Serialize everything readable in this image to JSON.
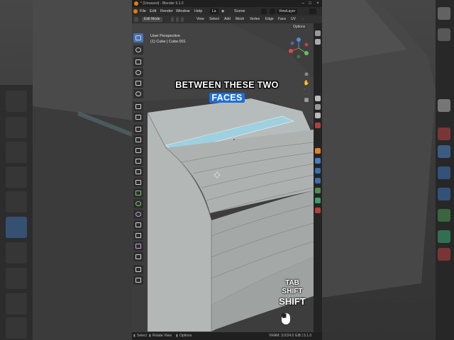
{
  "window": {
    "title": "* (Unsaved) - Blender 5.1.0"
  },
  "menu": {
    "file": "File",
    "edit": "Edit",
    "render": "Render",
    "window": "Window",
    "help": "Help",
    "layout_tab": "La",
    "scene": "Scene",
    "view_layer": "ViewLayer"
  },
  "viewport_header": {
    "mode": "Edit Mode",
    "view": "View",
    "select": "Select",
    "add": "Add",
    "mesh": "Mesh",
    "vertex": "Vertex",
    "edge": "Edge",
    "face": "Face",
    "uv": "UV",
    "options": "Options"
  },
  "viewport_info": {
    "perspective": "User Perspective",
    "object": "(1) Cube | Cube.001"
  },
  "caption": {
    "line1": "BETWEEN THESE TWO",
    "line2": "FACES"
  },
  "keys": {
    "line1": "TAB",
    "line2": "SHIFT",
    "line3": "SHIFT"
  },
  "status": {
    "select": "Select",
    "rotate": "Rotate View",
    "options": "Options",
    "vram": "VRAM: 3.0/24.0 GiB | 5.1.0"
  },
  "colors": {
    "accent": "#4772b3",
    "caption_highlight": "#1e6fdc",
    "selection": "#9fd0e0"
  },
  "icons": {
    "app": "blender-logo-icon",
    "cursor": "3d-cursor-icon",
    "gizmo": "navigation-gizmo-icon"
  }
}
